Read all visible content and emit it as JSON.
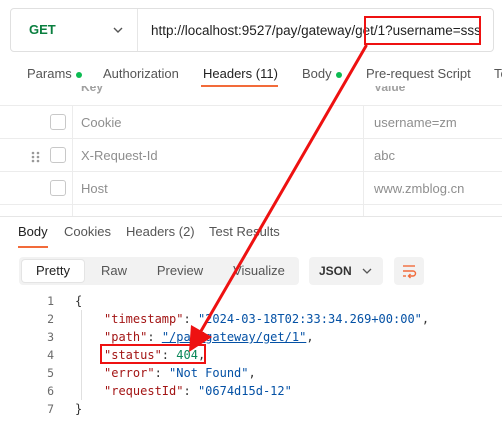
{
  "request": {
    "method": "GET",
    "url_part1": "http://localhost:9527/pay/gateway/ge",
    "url_part2": "t/1?username=sss"
  },
  "request_tabs": {
    "params": "Params",
    "authorization": "Authorization",
    "headers": "Headers (11)",
    "body": "Body",
    "pre_request": "Pre-request Script",
    "tests_partial": "Te"
  },
  "headers_table": {
    "col_key": "Key",
    "col_value": "Value",
    "rows": [
      {
        "key": "Cookie",
        "value": "username=zm"
      },
      {
        "key": "X-Request-Id",
        "value": "abc"
      },
      {
        "key": "Host",
        "value": "www.zmblog.cn"
      }
    ]
  },
  "response_tabs": {
    "body": "Body",
    "cookies": "Cookies",
    "headers": "Headers (2)",
    "test_results": "Test Results"
  },
  "view": {
    "pretty": "Pretty",
    "raw": "Raw",
    "preview": "Preview",
    "visualize": "Visualize",
    "format": "JSON"
  },
  "code": {
    "line_numbers": [
      "1",
      "2",
      "3",
      "4",
      "5",
      "6",
      "7"
    ],
    "open_brace": "{",
    "close_brace": "}",
    "timestamp_key": "\"timestamp\"",
    "timestamp_val": "\"2024-03-18T02:33:34.269+00:00\"",
    "path_key": "\"path\"",
    "path_val": "\"/pay/gateway/get/1\"",
    "status_key": "\"status\"",
    "status_val": "404",
    "error_key": "\"error\"",
    "error_val": "\"Not Found\"",
    "request_id_key": "\"requestId\"",
    "request_id_val": "\"0674d15d-12\"",
    "colon": ": ",
    "comma": ","
  },
  "colors": {
    "accent": "#f26b3a",
    "method_get": "#0a7f3f",
    "annotation_red": "#e11111",
    "indicator_green": "#0cbb52"
  },
  "icons": [
    "chevron-down-icon",
    "drag-handle-icon",
    "wrap-lines-icon"
  ]
}
